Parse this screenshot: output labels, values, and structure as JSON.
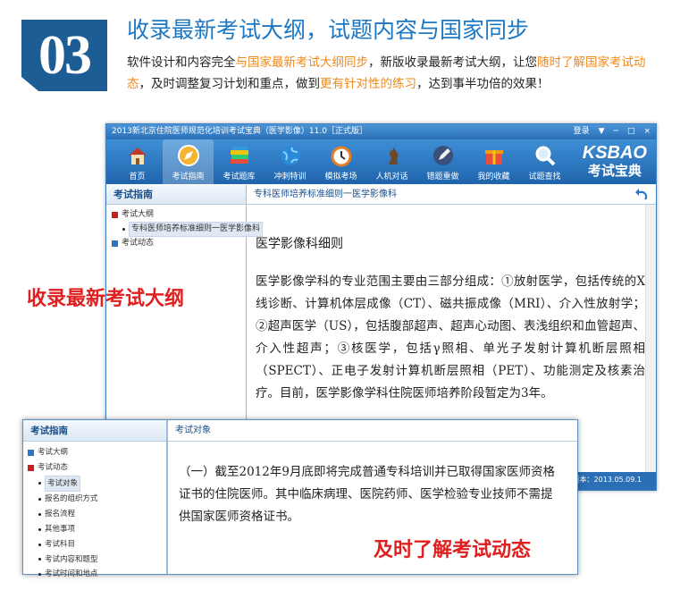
{
  "header": {
    "number": "03",
    "title": "收录最新考试大纲，试题内容与国家同步",
    "desc_parts": [
      {
        "text": "软件设计和内容完全",
        "hl": false
      },
      {
        "text": "与国家最新考试大纲同步",
        "hl": true
      },
      {
        "text": "，新版收录最新考试大纲，让您",
        "hl": false
      },
      {
        "text": "随时了解国家考试动态",
        "hl": true
      },
      {
        "text": "，及时调整复习计划和重点，做到",
        "hl": false
      },
      {
        "text": "更有针对性的练习",
        "hl": true
      },
      {
        "text": "，达到事半功倍的效果！",
        "hl": false
      }
    ],
    "highlight_color": "#f08a1a",
    "title_color": "#1d78c4"
  },
  "window": {
    "title": "2013新北京住院医师规范化培训考试宝典（医学影像）11.0［正式版］",
    "controls": {
      "login": "登录",
      "menu": "▼",
      "min": "─",
      "max": "□",
      "close": "×"
    },
    "toolbar": [
      {
        "label": "首页",
        "icon": "home-icon",
        "active": false
      },
      {
        "label": "考试指南",
        "icon": "compass-icon",
        "active": true
      },
      {
        "label": "考试题库",
        "icon": "books-icon",
        "active": false
      },
      {
        "label": "冲刺特训",
        "icon": "globe-icon",
        "active": false
      },
      {
        "label": "模拟考场",
        "icon": "clock-icon",
        "active": false
      },
      {
        "label": "人机对话",
        "icon": "chess-icon",
        "active": false
      },
      {
        "label": "错题重做",
        "icon": "pencil-icon",
        "active": false
      },
      {
        "label": "我的收藏",
        "icon": "gift-icon",
        "active": false
      },
      {
        "label": "试题查找",
        "icon": "magnifier-icon",
        "active": false
      }
    ],
    "logo": {
      "brand": "KSBAO",
      "sub": "考试宝典"
    },
    "sidebar": {
      "title": "考试指南",
      "tree": [
        {
          "label": "考试大纲",
          "expanded": true,
          "children": [
            {
              "label": "专科医师培养标准细则一医学影像科",
              "selected": true
            }
          ]
        },
        {
          "label": "考试动态",
          "expanded": false,
          "children": []
        }
      ]
    },
    "content": {
      "header": "专科医师培养标准细则一医学影像科",
      "title": "医学影像科细则",
      "body": "医学影像学科的专业范围主要由三部分组成：①放射医学，包括传统的X线诊断、计算机体层成像（CT）、磁共振成像（MRI）、介入性放射学；②超声医学（US），包括腹部超声、超声心动图、表浅组织和血管超声、介入性超声；③核医学，包括γ照相、单光子发射计算机断层照相（SPECT）、正电子发射计算机断层照相（PET）、功能测定及核素治疗。目前，医学影像学科住院医师培养阶段暂定为3年。"
    },
    "status": "版本：2013.05.09.1"
  },
  "labels": {
    "outline": "收录最新考试大纲",
    "news": "及时了解考试动态"
  },
  "overlay": {
    "sidebar_title": "考试指南",
    "tree": [
      {
        "label": "考试大纲",
        "expanded": false
      },
      {
        "label": "考试动态",
        "expanded": true
      }
    ],
    "children": [
      {
        "label": "考试对象",
        "selected": true
      },
      {
        "label": "报名的组织方式",
        "selected": false
      },
      {
        "label": "报名流程",
        "selected": false
      },
      {
        "label": "其他事项",
        "selected": false
      },
      {
        "label": "考试科目",
        "selected": false
      },
      {
        "label": "考试内容和题型",
        "selected": false
      },
      {
        "label": "考试时间和地点",
        "selected": false
      }
    ],
    "content_header": "考试对象",
    "body": "（一）截至2012年9月底即将完成普通专科培训并已取得国家医师资格证书的住院医师。其中临床病理、医院药师、医学检验专业技师不需提供国家医师资格证书。"
  }
}
